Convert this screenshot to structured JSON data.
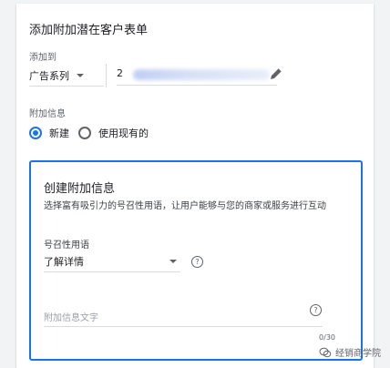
{
  "form": {
    "title": "添加附加潜在客户表单",
    "add_to_label": "添加到",
    "scope_dropdown_value": "广告系列",
    "target_value": "2",
    "extension_info_label": "附加信息",
    "radio_new": "新建",
    "radio_existing": "使用现有的",
    "radio_selected": "new"
  },
  "panel": {
    "title": "创建附加信息",
    "description": "选择富有吸引力的号召性用语，让用户能够与您的商家或服务进行互动",
    "cta_label": "号召性用语",
    "cta_value": "了解详情",
    "text_placeholder": "附加信息文字",
    "counter": "0/30"
  },
  "watermark": {
    "text": "经销商学院"
  },
  "colors": {
    "accent": "#1a73e8",
    "border": "#dadce0",
    "muted": "#5f6368"
  },
  "icons": [
    "dropdown-arrow-icon",
    "pencil-edit-icon",
    "help-icon",
    "wechat-logo-icon"
  ]
}
